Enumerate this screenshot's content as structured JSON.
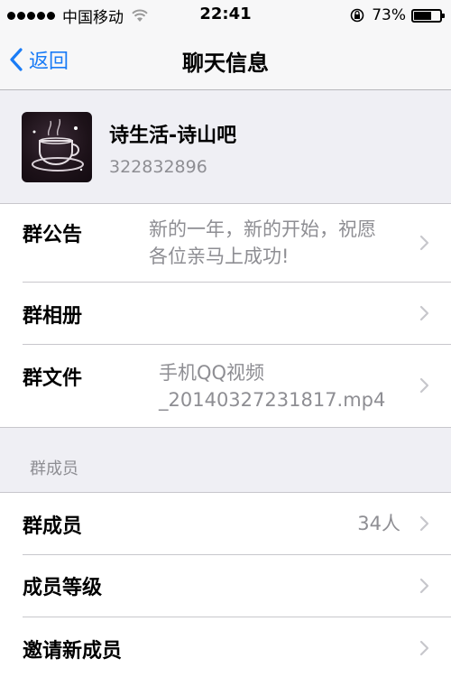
{
  "status_bar": {
    "carrier": "中国移动",
    "time": "22:41",
    "battery": "73%",
    "battery_level": 0.73
  },
  "nav": {
    "back_label": "返回",
    "title": "聊天信息"
  },
  "group": {
    "name": "诗生活-诗山吧",
    "id": "322832896"
  },
  "info_cells": {
    "announcement": {
      "label": "群公告",
      "value_line1": "新的一年，新的开始，祝愿",
      "value_line2": "各位亲马上成功!"
    },
    "album": {
      "label": "群相册"
    },
    "files": {
      "label": "群文件",
      "value_line1": "手机QQ视频",
      "value_line2": "_20140327231817.mp4"
    }
  },
  "members_section": {
    "header": "群成员",
    "members": {
      "label": "群成员",
      "value": "34人"
    },
    "level": {
      "label": "成员等级"
    },
    "invite": {
      "label": "邀请新成员"
    }
  },
  "colors": {
    "accent": "#1a7cf6",
    "background": "#efeff4",
    "secondary_text": "#8e8e93",
    "separator": "#c8c7cc"
  }
}
